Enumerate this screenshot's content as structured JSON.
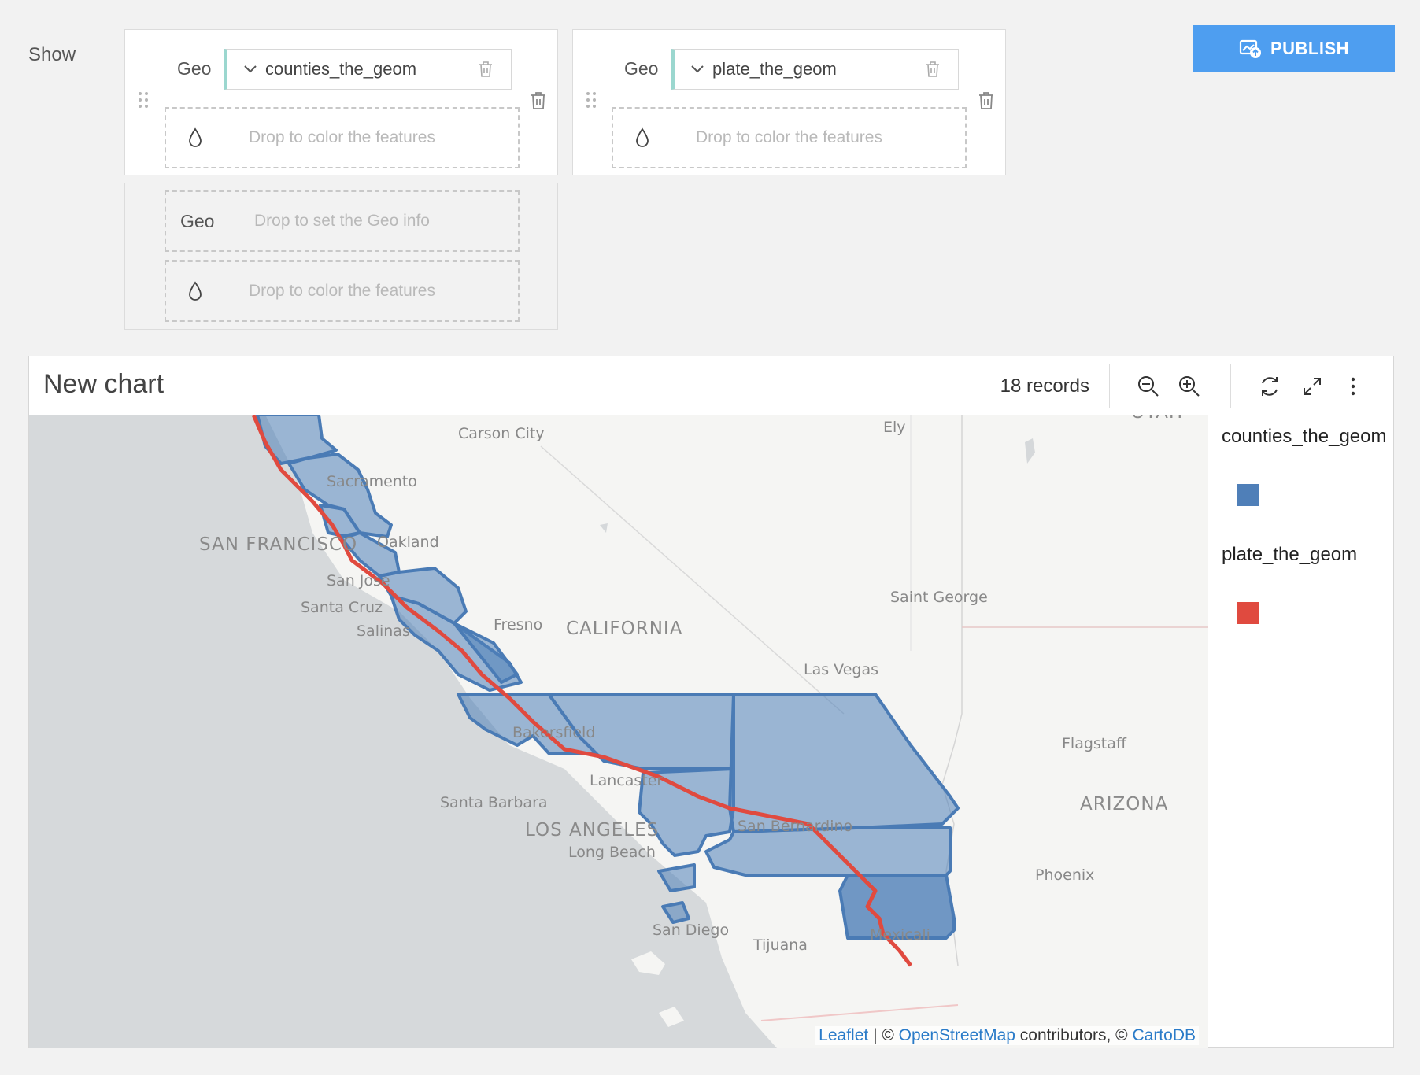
{
  "show_label": "Show",
  "layers": [
    {
      "geo_label": "Geo",
      "geo_field": "counties_the_geom",
      "color_drop_text": "Drop to color the features"
    },
    {
      "geo_label": "Geo",
      "geo_field": "plate_the_geom",
      "color_drop_text": "Drop to color the features"
    },
    {
      "geo_label": "Geo",
      "geo_drop_text": "Drop to set the Geo info",
      "color_drop_text": "Drop to color the features"
    }
  ],
  "publish_label": "PUBLISH",
  "chart": {
    "title": "New chart",
    "records": "18 records"
  },
  "map": {
    "places": {
      "carson_city": "Carson City",
      "ely": "Ely",
      "sacramento": "Sacramento",
      "san_francisco": "SAN FRANCISCO",
      "oakland": "Oakland",
      "san_jose": "San Jose",
      "santa_cruz": "Santa Cruz",
      "salinas": "Salinas",
      "fresno": "Fresno",
      "california": "CALIFORNIA",
      "saint_george": "Saint George",
      "las_vegas": "Las Vegas",
      "bakersfield": "Bakersfield",
      "flagstaff": "Flagstaff",
      "lancaster": "Lancaster",
      "santa_barbara": "Santa Barbara",
      "arizona": "ARIZONA",
      "los_angeles": "LOS ANGELES",
      "san_bernardino": "San Bernardino",
      "long_beach": "Long Beach",
      "phoenix": "Phoenix",
      "san_diego": "San Diego",
      "tijuana": "Tijuana",
      "mexicali": "Mexicali",
      "utah": "UTAH"
    },
    "attribution": {
      "leaflet": "Leaflet",
      "sep": " | © ",
      "osm": "OpenStreetMap",
      "contributors": " contributors, © ",
      "carto": "CartoDB"
    },
    "county_fill": "#4f7fb8",
    "plate_color": "#e04a3f"
  },
  "legend": [
    {
      "label": "counties_the_geom",
      "color": "#4f7fb8"
    },
    {
      "label": "plate_the_geom",
      "color": "#e04a3f"
    }
  ]
}
